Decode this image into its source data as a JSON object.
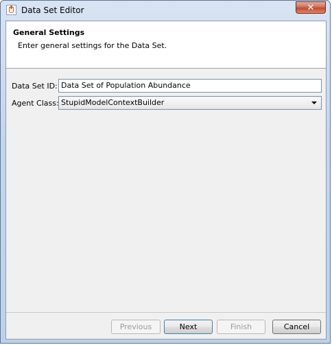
{
  "window": {
    "title": "Data Set Editor"
  },
  "header": {
    "title": "General Settings",
    "description": "Enter general settings for the Data Set."
  },
  "form": {
    "dataset_id_label": "Data Set ID:",
    "dataset_id_value": "Data Set of Population Abundance",
    "agent_class_label": "Agent Class:",
    "agent_class_value": "StupidModelContextBuilder"
  },
  "buttons": {
    "previous": "Previous",
    "next": "Next",
    "finish": "Finish",
    "cancel": "Cancel"
  },
  "icons": {
    "app": "java-cup-icon",
    "close": "close-icon",
    "dropdown": "chevron-down-icon"
  }
}
